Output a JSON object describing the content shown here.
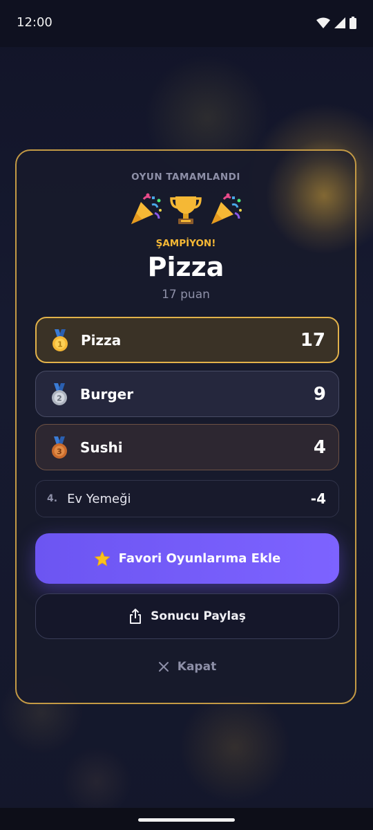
{
  "status_bar": {
    "time": "12:00"
  },
  "dialog": {
    "top_label": "OYUN TAMAMLANDI",
    "champion_label": "ŞAMPİYON!",
    "winner_name": "Pizza",
    "winner_points": "17 puan",
    "colors": {
      "accent": "#f5b835",
      "border": "#c49a45",
      "primary_button": "#7059f5"
    }
  },
  "ranking": [
    {
      "medal": "gold-medal-icon",
      "name": "Pizza",
      "score": "17"
    },
    {
      "medal": "silver-medal-icon",
      "name": "Burger",
      "score": "9"
    },
    {
      "medal": "bronze-medal-icon",
      "name": "Sushi",
      "score": "4"
    },
    {
      "position": "4.",
      "name": "Ev Yemeği",
      "score": "-4"
    }
  ],
  "actions": {
    "favorite_label": "Favori Oyunlarıma Ekle",
    "favorite_icon": "star-icon",
    "share_label": "Sonucu Paylaş",
    "share_icon": "share-icon",
    "close_label": "Kapat",
    "close_icon": "close-icon"
  }
}
